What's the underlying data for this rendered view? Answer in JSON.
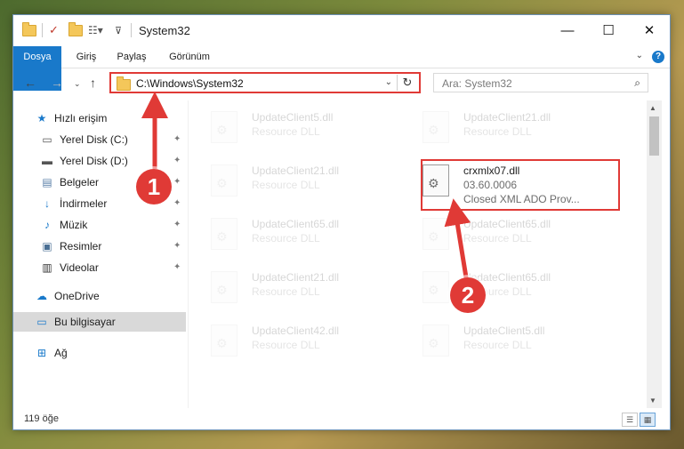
{
  "window": {
    "title": "System32",
    "controls": {
      "minimize": "—",
      "maximize": "☐",
      "close": "✕"
    }
  },
  "ribbon": {
    "tabs": [
      "Dosya",
      "Giriş",
      "Paylaş",
      "Görünüm"
    ],
    "help": "?"
  },
  "address": {
    "path": "C:\\Windows\\System32",
    "dropdown": "⌄",
    "refresh": "↻"
  },
  "search": {
    "placeholder": "Ara: System32",
    "icon": "search-icon"
  },
  "nav": {
    "items": [
      {
        "label": "Hızlı erişim",
        "icon": "star-icon",
        "pinned": false
      },
      {
        "label": "Yerel Disk (C:)",
        "icon": "drive-icon",
        "pinned": true
      },
      {
        "label": "Yerel Disk (D:)",
        "icon": "drive-icon",
        "pinned": true
      },
      {
        "label": "Belgeler",
        "icon": "document-icon",
        "pinned": true
      },
      {
        "label": "İndirmeler",
        "icon": "download-icon",
        "pinned": true
      },
      {
        "label": "Müzik",
        "icon": "music-icon",
        "pinned": true
      },
      {
        "label": "Resimler",
        "icon": "pictures-icon",
        "pinned": true
      },
      {
        "label": "Videolar",
        "icon": "video-icon",
        "pinned": true
      },
      {
        "label": "OneDrive",
        "icon": "cloud-icon",
        "pinned": false
      },
      {
        "label": "Bu bilgisayar",
        "icon": "computer-icon",
        "pinned": false,
        "selected": true
      },
      {
        "label": "Ağ",
        "icon": "network-icon",
        "pinned": false
      }
    ]
  },
  "files": [
    {
      "name": "UpdateClient5.dll",
      "desc": "Resource DLL"
    },
    {
      "name": "UpdateClient21.dll",
      "desc": "Resource DLL"
    },
    {
      "name": "UpdateClient21.dll",
      "desc": "Resource DLL"
    },
    {
      "name": "crxmlx07.dll",
      "desc": "03.60.0006",
      "desc2": "Closed XML ADO Prov..."
    },
    {
      "name": "UpdateClient65.dll",
      "desc": "Resource DLL"
    },
    {
      "name": "UpdateClient65.dll",
      "desc": "Resource DLL"
    },
    {
      "name": "UpdateClient21.dll",
      "desc": "Resource DLL"
    },
    {
      "name": "UpdateClient65.dll",
      "desc": "Resource DLL"
    },
    {
      "name": "UpdateClient42.dll",
      "desc": "Resource DLL"
    },
    {
      "name": "UpdateClient5.dll",
      "desc": "Resource DLL"
    }
  ],
  "status": {
    "count": "119 öğe"
  },
  "annotations": {
    "step1": "1",
    "step2": "2",
    "color": "#e03a36"
  }
}
